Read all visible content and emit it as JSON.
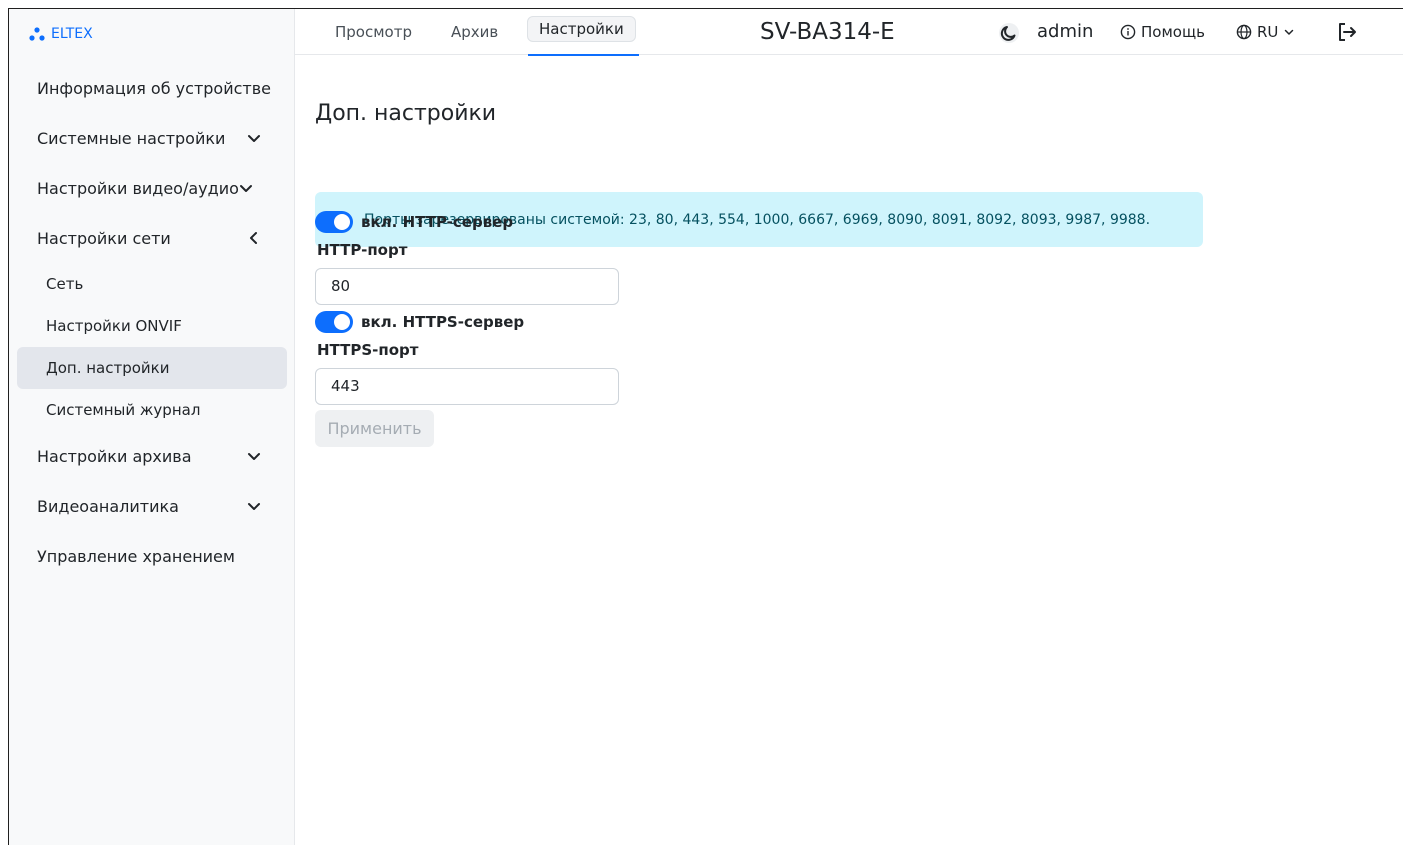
{
  "brand": {
    "name": "ELTEX"
  },
  "topbar": {
    "tabs": [
      {
        "label": "Просмотр"
      },
      {
        "label": "Архив"
      },
      {
        "label": "Настройки"
      }
    ],
    "device_title": "SV-BA314-E",
    "user": "admin",
    "help_label": "Помощь",
    "lang_label": "RU"
  },
  "sidebar": {
    "items": [
      {
        "label": "Информация об устройстве"
      },
      {
        "label": "Системные настройки"
      },
      {
        "label": "Настройки видео/аудио"
      },
      {
        "label": "Настройки сети"
      },
      {
        "label": "Сеть"
      },
      {
        "label": "Настройки ONVIF"
      },
      {
        "label": "Доп. настройки"
      },
      {
        "label": "Системный журнал"
      },
      {
        "label": "Настройки архива"
      },
      {
        "label": "Видеоаналитика"
      },
      {
        "label": "Управление хранением"
      }
    ]
  },
  "main": {
    "title": "Доп. настройки",
    "alert": "Порты зарезервированы системой: 23, 80, 443, 554, 1000, 6667, 6969, 8090, 8091, 8092, 8093, 9987, 9988.",
    "http_toggle_label": "вкл. HTTP-сервер",
    "http_port_label": "HTTP-порт",
    "http_port_value": "80",
    "https_toggle_label": "вкл. HTTPS-сервер",
    "https_port_label": "HTTPS-порт",
    "https_port_value": "443",
    "apply_label": "Применить"
  },
  "colors": {
    "accent": "#0d6efd",
    "alert_bg": "#cff4fc",
    "alert_text": "#055160",
    "active_nav_bg": "#e3e6ec"
  }
}
